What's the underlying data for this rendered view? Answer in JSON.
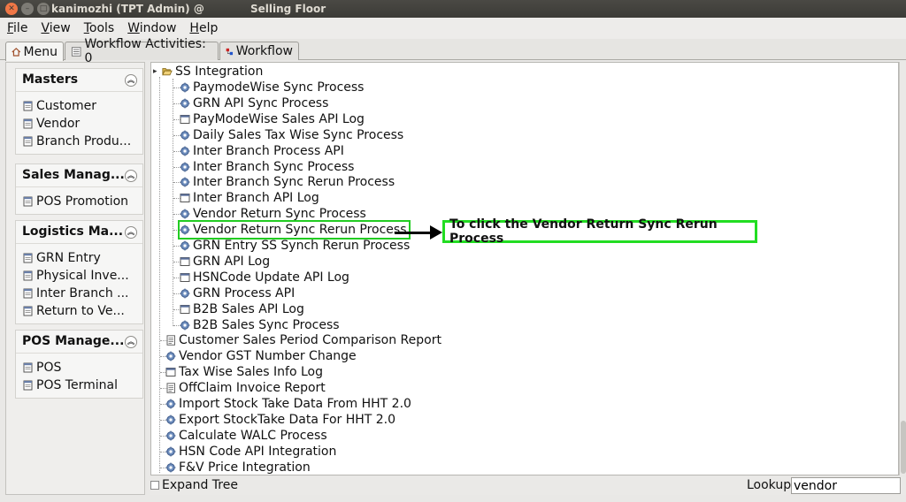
{
  "window": {
    "title": "kanimozhi (TPT Admin) @",
    "center_title": "Selling Floor"
  },
  "menubar": [
    {
      "label": "File",
      "mnemonic": "F",
      "rest": "ile"
    },
    {
      "label": "View",
      "mnemonic": "V",
      "rest": "iew"
    },
    {
      "label": "Tools",
      "mnemonic": "T",
      "rest": "ools"
    },
    {
      "label": "Window",
      "mnemonic": "W",
      "rest": "indow"
    },
    {
      "label": "Help",
      "mnemonic": "H",
      "rest": "elp"
    }
  ],
  "tabs": [
    {
      "label": "Menu",
      "icon": "home-icon",
      "active": true
    },
    {
      "label": "Workflow Activities: 0",
      "icon": "workflow-activities-icon",
      "active": false
    },
    {
      "label": "Workflow",
      "icon": "workflow-icon",
      "active": false
    }
  ],
  "sections": [
    {
      "title": "Masters",
      "items": [
        "Customer",
        "Vendor",
        "Branch Produ..."
      ]
    },
    {
      "title": "Sales Manag...",
      "items": [
        "POS Promotion"
      ]
    },
    {
      "title": "Logistics Ma...",
      "items": [
        "GRN Entry",
        "Physical Inve...",
        "Inter Branch ...",
        "Return to Ve..."
      ]
    },
    {
      "title": "POS Manage...",
      "items": [
        "POS",
        "POS Terminal"
      ]
    }
  ],
  "tree": {
    "folder": "SS Integration",
    "children": [
      {
        "label": "PaymodeWise Sync Process",
        "icon": "process-icon"
      },
      {
        "label": "GRN API Sync Process",
        "icon": "process-icon"
      },
      {
        "label": "PayModeWise Sales API Log",
        "icon": "window-icon"
      },
      {
        "label": "Daily Sales Tax Wise Sync Process",
        "icon": "process-icon"
      },
      {
        "label": "Inter Branch Process API",
        "icon": "process-icon"
      },
      {
        "label": "Inter Branch Sync Process",
        "icon": "process-icon"
      },
      {
        "label": "Inter Branch Sync Rerun Process",
        "icon": "process-icon"
      },
      {
        "label": "Inter Branch API Log",
        "icon": "window-icon"
      },
      {
        "label": "Vendor Return Sync Process",
        "icon": "process-icon"
      },
      {
        "label": "Vendor Return Sync Rerun Process",
        "icon": "process-icon",
        "highlighted": true
      },
      {
        "label": "GRN Entry SS Synch Rerun Process",
        "icon": "process-icon"
      },
      {
        "label": "GRN API Log",
        "icon": "window-icon"
      },
      {
        "label": "HSNCode Update API Log",
        "icon": "window-icon"
      },
      {
        "label": "GRN Process API",
        "icon": "process-icon"
      },
      {
        "label": "B2B Sales API Log",
        "icon": "window-icon"
      },
      {
        "label": "B2B Sales Sync Process",
        "icon": "process-icon"
      }
    ],
    "top_level": [
      {
        "label": "Customer Sales Period Comparison Report",
        "icon": "report-icon"
      },
      {
        "label": "Vendor GST Number Change",
        "icon": "process-icon"
      },
      {
        "label": "Tax Wise Sales Info Log",
        "icon": "window-icon"
      },
      {
        "label": "OffClaim Invoice Report",
        "icon": "report-icon"
      },
      {
        "label": "Import Stock Take Data From HHT 2.0",
        "icon": "process-icon"
      },
      {
        "label": "Export StockTake Data For HHT 2.0",
        "icon": "process-icon"
      },
      {
        "label": "Calculate WALC Process",
        "icon": "process-icon"
      },
      {
        "label": "HSN Code API Integration",
        "icon": "process-icon"
      },
      {
        "label": "F&V Price Integration",
        "icon": "process-icon"
      }
    ]
  },
  "annotation": {
    "callout_text": "To click the Vendor Return Sync Rerun Process"
  },
  "bottom": {
    "expand_tree_label": "Expand Tree",
    "lookup_label": "Lookup",
    "lookup_value": "vendor"
  },
  "colors": {
    "highlight": "#22cc22",
    "titlebar": "#3c3b37",
    "close_button": "#f07746"
  }
}
